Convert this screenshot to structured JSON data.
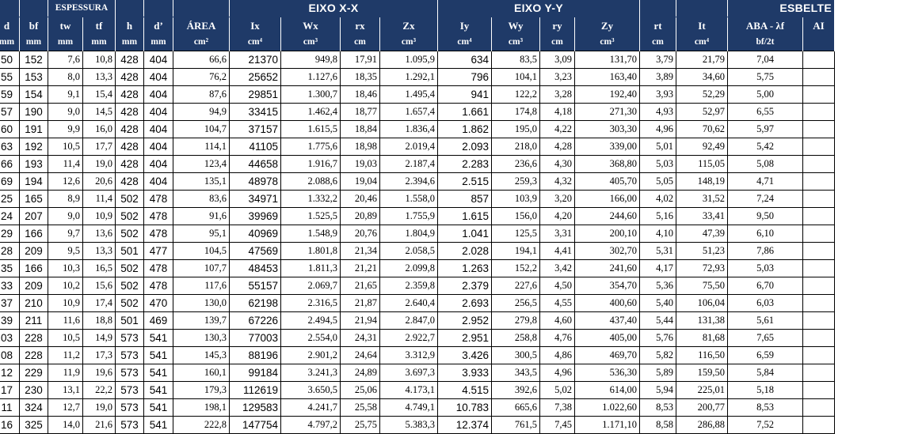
{
  "header": {
    "groups": {
      "espessura": "ESPESSURA",
      "eixo_x": "EIXO X-X",
      "eixo_y": "EIXO Y-Y",
      "esbeltez": "ESBELTE"
    },
    "columns": [
      "d",
      "bf",
      "tw",
      "tf",
      "h",
      "d’",
      "ÁREA",
      "Ix",
      "Wx",
      "rx",
      "Zx",
      "Iy",
      "Wy",
      "ry",
      "Zy",
      "rt",
      "It",
      "ABA - λf",
      "AI"
    ],
    "units": [
      "mm",
      "mm",
      "mm",
      "mm",
      "mm",
      "mm",
      "cm²",
      "cm⁴",
      "cm³",
      "cm",
      "cm³",
      "cm⁴",
      "cm³",
      "cm",
      "cm³",
      "cm",
      "cm⁴",
      "bf/2t",
      ""
    ]
  },
  "rows": [
    [
      "50",
      "152",
      "7,6",
      "10,8",
      "428",
      "404",
      "66,6",
      "21370",
      "949,8",
      "17,91",
      "1.095,9",
      "634",
      "83,5",
      "3,09",
      "131,70",
      "3,79",
      "21,79",
      "7,04",
      ""
    ],
    [
      "55",
      "153",
      "8,0",
      "13,3",
      "428",
      "404",
      "76,2",
      "25652",
      "1.127,6",
      "18,35",
      "1.292,1",
      "796",
      "104,1",
      "3,23",
      "163,40",
      "3,89",
      "34,60",
      "5,75",
      ""
    ],
    [
      "59",
      "154",
      "9,1",
      "15,4",
      "428",
      "404",
      "87,6",
      "29851",
      "1.300,7",
      "18,46",
      "1.495,4",
      "941",
      "122,2",
      "3,28",
      "192,40",
      "3,93",
      "52,29",
      "5,00",
      ""
    ],
    [
      "57",
      "190",
      "9,0",
      "14,5",
      "428",
      "404",
      "94,9",
      "33415",
      "1.462,4",
      "18,77",
      "1.657,4",
      "1.661",
      "174,8",
      "4,18",
      "271,30",
      "4,93",
      "52,97",
      "6,55",
      ""
    ],
    [
      "60",
      "191",
      "9,9",
      "16,0",
      "428",
      "404",
      "104,7",
      "37157",
      "1.615,5",
      "18,84",
      "1.836,4",
      "1.862",
      "195,0",
      "4,22",
      "303,30",
      "4,96",
      "70,62",
      "5,97",
      ""
    ],
    [
      "63",
      "192",
      "10,5",
      "17,7",
      "428",
      "404",
      "114,1",
      "41105",
      "1.775,6",
      "18,98",
      "2.019,4",
      "2.093",
      "218,0",
      "4,28",
      "339,00",
      "5,01",
      "92,49",
      "5,42",
      ""
    ],
    [
      "66",
      "193",
      "11,4",
      "19,0",
      "428",
      "404",
      "123,4",
      "44658",
      "1.916,7",
      "19,03",
      "2.187,4",
      "2.283",
      "236,6",
      "4,30",
      "368,80",
      "5,03",
      "115,05",
      "5,08",
      ""
    ],
    [
      "69",
      "194",
      "12,6",
      "20,6",
      "428",
      "404",
      "135,1",
      "48978",
      "2.088,6",
      "19,04",
      "2.394,6",
      "2.515",
      "259,3",
      "4,32",
      "405,70",
      "5,05",
      "148,19",
      "4,71",
      ""
    ],
    [
      "25",
      "165",
      "8,9",
      "11,4",
      "502",
      "478",
      "83,6",
      "34971",
      "1.332,2",
      "20,46",
      "1.558,0",
      "857",
      "103,9",
      "3,20",
      "166,00",
      "4,02",
      "31,52",
      "7,24",
      ""
    ],
    [
      "24",
      "207",
      "9,0",
      "10,9",
      "502",
      "478",
      "91,6",
      "39969",
      "1.525,5",
      "20,89",
      "1.755,9",
      "1.615",
      "156,0",
      "4,20",
      "244,60",
      "5,16",
      "33,41",
      "9,50",
      ""
    ],
    [
      "29",
      "166",
      "9,7",
      "13,6",
      "502",
      "478",
      "95,1",
      "40969",
      "1.548,9",
      "20,76",
      "1.804,9",
      "1.041",
      "125,5",
      "3,31",
      "200,10",
      "4,10",
      "47,39",
      "6,10",
      ""
    ],
    [
      "28",
      "209",
      "9,5",
      "13,3",
      "501",
      "477",
      "104,5",
      "47569",
      "1.801,8",
      "21,34",
      "2.058,5",
      "2.028",
      "194,1",
      "4,41",
      "302,70",
      "5,31",
      "51,23",
      "7,86",
      ""
    ],
    [
      "35",
      "166",
      "10,3",
      "16,5",
      "502",
      "478",
      "107,7",
      "48453",
      "1.811,3",
      "21,21",
      "2.099,8",
      "1.263",
      "152,2",
      "3,42",
      "241,60",
      "4,17",
      "72,93",
      "5,03",
      ""
    ],
    [
      "33",
      "209",
      "10,2",
      "15,6",
      "502",
      "478",
      "117,6",
      "55157",
      "2.069,7",
      "21,65",
      "2.359,8",
      "2.379",
      "227,6",
      "4,50",
      "354,70",
      "5,36",
      "75,50",
      "6,70",
      ""
    ],
    [
      "37",
      "210",
      "10,9",
      "17,4",
      "502",
      "470",
      "130,0",
      "62198",
      "2.316,5",
      "21,87",
      "2.640,4",
      "2.693",
      "256,5",
      "4,55",
      "400,60",
      "5,40",
      "106,04",
      "6,03",
      ""
    ],
    [
      "39",
      "211",
      "11,6",
      "18,8",
      "501",
      "469",
      "139,7",
      "67226",
      "2.494,5",
      "21,94",
      "2.847,0",
      "2.952",
      "279,8",
      "4,60",
      "437,40",
      "5,44",
      "131,38",
      "5,61",
      ""
    ],
    [
      "03",
      "228",
      "10,5",
      "14,9",
      "573",
      "541",
      "130,3",
      "77003",
      "2.554,0",
      "24,31",
      "2.922,7",
      "2.951",
      "258,8",
      "4,76",
      "405,00",
      "5,76",
      "81,68",
      "7,65",
      ""
    ],
    [
      "08",
      "228",
      "11,2",
      "17,3",
      "573",
      "541",
      "145,3",
      "88196",
      "2.901,2",
      "24,64",
      "3.312,9",
      "3.426",
      "300,5",
      "4,86",
      "469,70",
      "5,82",
      "116,50",
      "6,59",
      ""
    ],
    [
      "12",
      "229",
      "11,9",
      "19,6",
      "573",
      "541",
      "160,1",
      "99184",
      "3.241,3",
      "24,89",
      "3.697,3",
      "3.933",
      "343,5",
      "4,96",
      "536,30",
      "5,89",
      "159,50",
      "5,84",
      ""
    ],
    [
      "17",
      "230",
      "13,1",
      "22,2",
      "573",
      "541",
      "179,3",
      "112619",
      "3.650,5",
      "25,06",
      "4.173,1",
      "4.515",
      "392,6",
      "5,02",
      "614,00",
      "5,94",
      "225,01",
      "5,18",
      ""
    ],
    [
      "11",
      "324",
      "12,7",
      "19,0",
      "573",
      "541",
      "198,1",
      "129583",
      "4.241,7",
      "25,58",
      "4.749,1",
      "10.783",
      "665,6",
      "7,38",
      "1.022,60",
      "8,53",
      "200,77",
      "8,53",
      ""
    ],
    [
      "16",
      "325",
      "14,0",
      "21,6",
      "573",
      "541",
      "222,8",
      "147754",
      "4.797,2",
      "25,75",
      "5.383,3",
      "12.374",
      "761,5",
      "7,45",
      "1.171,10",
      "8,58",
      "286,88",
      "7,52",
      ""
    ]
  ]
}
